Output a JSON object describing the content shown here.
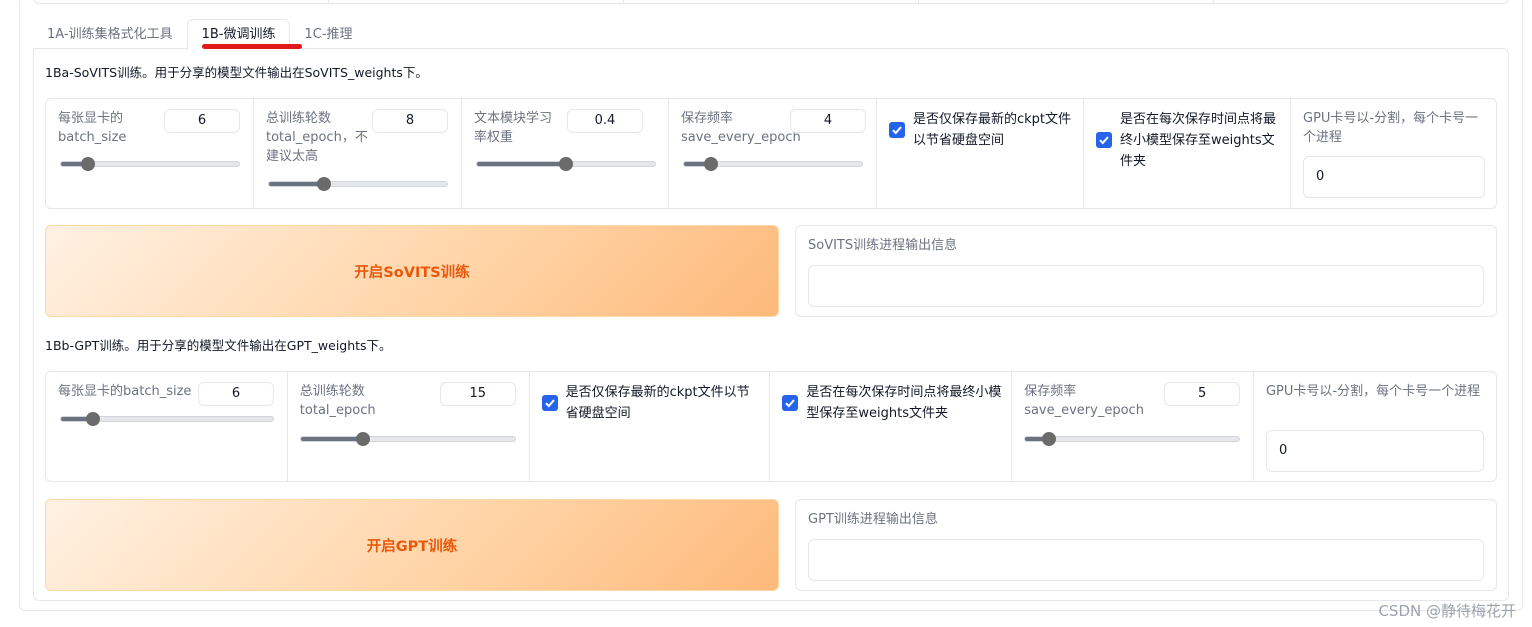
{
  "tabs": [
    {
      "label": "1A-训练集格式化工具"
    },
    {
      "label": "1B-微调训练"
    },
    {
      "label": "1C-推理"
    }
  ],
  "sovits": {
    "title": "1Ba-SoVITS训练。用于分享的模型文件输出在SoVITS_weights下。",
    "batch_size": {
      "label": "每张显卡的batch_size",
      "value": "6",
      "fraction": 0.15
    },
    "total_epoch": {
      "label": "总训练轮数total_epoch，不建议太高",
      "value": "8",
      "fraction": 0.31
    },
    "text_lr": {
      "label": "文本模块学习率权重",
      "value": "0.4",
      "fraction": 0.5
    },
    "save_every": {
      "label": "保存频率save_every_epoch",
      "value": "4",
      "fraction": 0.15
    },
    "save_latest": {
      "label": "是否仅保存最新的ckpt文件以节省硬盘空间",
      "checked": true
    },
    "save_weights": {
      "label": "是否在每次保存时间点将最终小模型保存至weights文件夹",
      "checked": true
    },
    "gpu": {
      "label": "GPU卡号以-分割，每个卡号一个进程",
      "value": "0"
    },
    "start_button": "开启SoVITS训练",
    "output_label": "SoVITS训练进程输出信息"
  },
  "gpt": {
    "title": "1Bb-GPT训练。用于分享的模型文件输出在GPT_weights下。",
    "batch_size": {
      "label": "每张显卡的batch_size",
      "value": "6",
      "fraction": 0.15
    },
    "total_epoch": {
      "label": "总训练轮数total_epoch",
      "value": "15",
      "fraction": 0.29
    },
    "save_latest": {
      "label": "是否仅保存最新的ckpt文件以节省硬盘空间",
      "checked": true
    },
    "save_weights": {
      "label": "是否在每次保存时间点将最终小模型保存至weights文件夹",
      "checked": true
    },
    "save_every": {
      "label": "保存频率save_every_epoch",
      "value": "5",
      "fraction": 0.11
    },
    "gpu": {
      "label": "GPU卡号以-分割，每个卡号一个进程",
      "value": "0"
    },
    "start_button": "开启GPT训练",
    "output_label": "GPT训练进程输出信息"
  },
  "watermark": "CSDN @静待梅花开",
  "colors": {
    "accent_check": "#2563eb",
    "button_text": "#ea580c",
    "tab_underline": "#e0191b"
  }
}
